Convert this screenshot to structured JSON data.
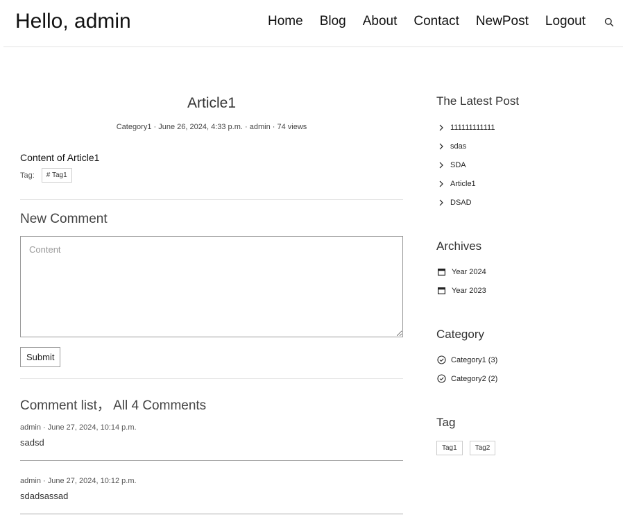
{
  "header": {
    "brand": "Hello, admin",
    "nav": [
      "Home",
      "Blog",
      "About",
      "Contact",
      "NewPost",
      "Logout"
    ]
  },
  "article": {
    "title": "Article1",
    "category": "Category1",
    "date": "June 26, 2024, 4:33 p.m.",
    "author": "admin",
    "views": "74 views",
    "separator": " · ",
    "content": "Content of Article1",
    "tag_label": "Tag:",
    "tags": [
      "# Tag1"
    ]
  },
  "new_comment": {
    "title": "New Comment",
    "placeholder": "Content",
    "submit_label": "Submit"
  },
  "comment_list": {
    "title": "Comment list，  All 4 Comments",
    "comments": [
      {
        "meta": "admin · June 27, 2024, 10:14 p.m.",
        "body": "sadsd"
      },
      {
        "meta": "admin · June 27, 2024, 10:12 p.m.",
        "body": "sdadsassad"
      }
    ]
  },
  "sidebar": {
    "latest_title": "The Latest Post",
    "latest": [
      "111111111111",
      "sdas",
      "SDA",
      "Article1",
      "DSAD"
    ],
    "archives_title": "Archives",
    "archives": [
      "Year 2024",
      "Year 2023"
    ],
    "category_title": "Category",
    "categories": [
      "Category1 (3)",
      "Category2 (2)"
    ],
    "tag_title": "Tag",
    "tags": [
      "Tag1",
      "Tag2"
    ]
  },
  "icons": {
    "search": "search-icon",
    "latest_item": "chevron-right-icon",
    "archive_item": "calendar-icon",
    "category_item": "check-circle-icon"
  }
}
